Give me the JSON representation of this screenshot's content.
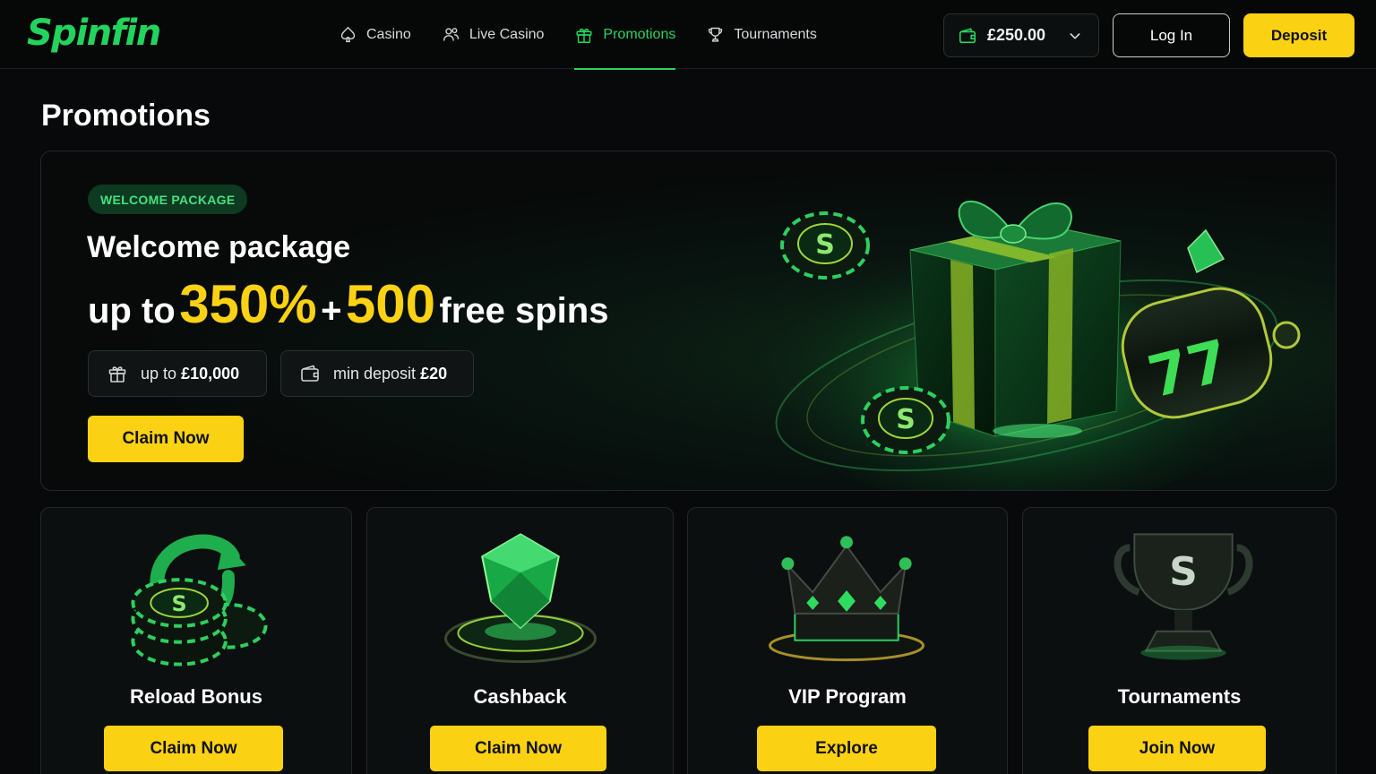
{
  "brand": {
    "name": "Spinfin",
    "color": "#22d35d",
    "accent_yellow": "#fbd213"
  },
  "nav": {
    "items": [
      {
        "label": "Casino",
        "icon": "spade-icon",
        "active": false
      },
      {
        "label": "Live Casino",
        "icon": "users-icon",
        "active": false
      },
      {
        "label": "Promotions",
        "icon": "gift-icon",
        "active": true
      },
      {
        "label": "Tournaments",
        "icon": "trophy-icon",
        "active": false
      }
    ]
  },
  "account": {
    "balance": "£250.00",
    "balance_icon": "wallet-icon",
    "login_label": "Log In",
    "deposit_label": "Deposit"
  },
  "page": {
    "title": "Promotions"
  },
  "hero": {
    "badge": "WELCOME PACKAGE",
    "title": "Welcome package",
    "offer_prefix": "up to",
    "offer_percent": "350%",
    "offer_plus": "+",
    "offer_spins": "500",
    "offer_suffix": "free spins",
    "chip_bonus_prefix": "up to",
    "chip_bonus_value": "£10,000",
    "chip_deposit_prefix": "min deposit",
    "chip_deposit_value": "£20",
    "claim_label": "Claim Now",
    "art": "gift-box-chips-slot-reel-illustration"
  },
  "cards": [
    {
      "title": "Reload Bonus",
      "button": "Claim Now",
      "art": "reload-chips-icon"
    },
    {
      "title": "Cashback",
      "button": "Claim Now",
      "art": "emerald-gem-icon"
    },
    {
      "title": "VIP Program",
      "button": "Explore",
      "art": "crown-icon"
    },
    {
      "title": "Tournaments",
      "button": "Join Now",
      "art": "trophy-cup-icon"
    }
  ]
}
